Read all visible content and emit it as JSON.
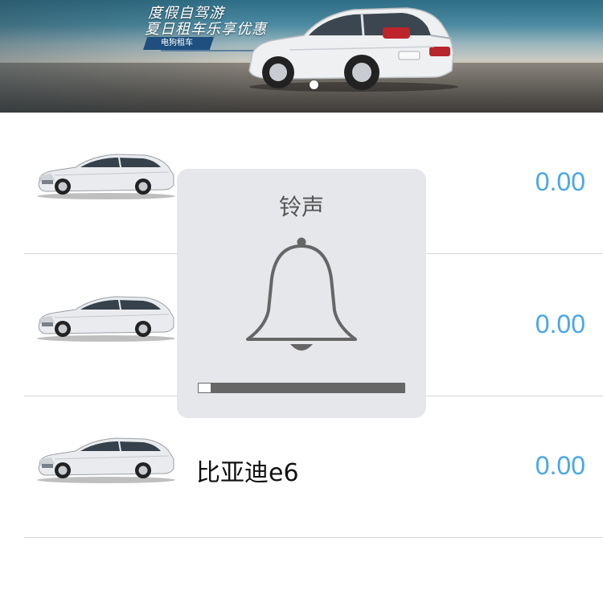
{
  "banner": {
    "headline": "度假自驾游",
    "subline": "夏日租车乐享优惠",
    "tag": "电狗租车",
    "current_slide": 1,
    "slide_count": 1
  },
  "cars": [
    {
      "name": "",
      "price": "0.00"
    },
    {
      "name": "",
      "price": "0.00"
    },
    {
      "name": "比亚迪e6",
      "price": "0.00"
    }
  ],
  "volume_hud": {
    "title": "铃声",
    "icon": "bell-icon",
    "level": 0.06
  },
  "colors": {
    "price": "#4aa7e8",
    "divider": "#d6d6d6",
    "hud_background": "#e5e6ea",
    "hud_track": "#666666"
  }
}
